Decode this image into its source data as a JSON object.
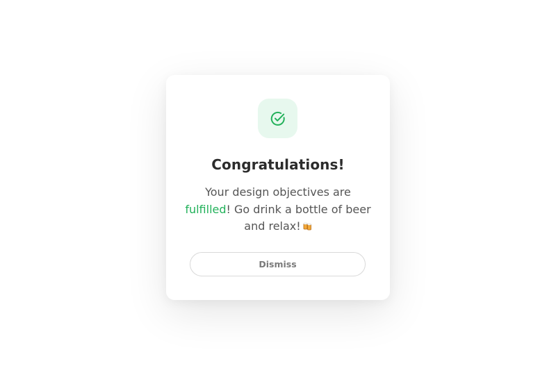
{
  "dialog": {
    "icon": "check-circle-icon",
    "title": "Congratulations!",
    "message": {
      "before": "Your design objectives are ",
      "highlight": "fulfilled",
      "after": "! Go drink a bottle of beer and relax!",
      "emoji": "beer-mugs-icon"
    },
    "dismiss_label": "Dismiss"
  },
  "colors": {
    "accent": "#22b15a",
    "icon_tile_bg": "#e7f8ee",
    "title": "#2c2c2c",
    "body_text": "#555555"
  }
}
